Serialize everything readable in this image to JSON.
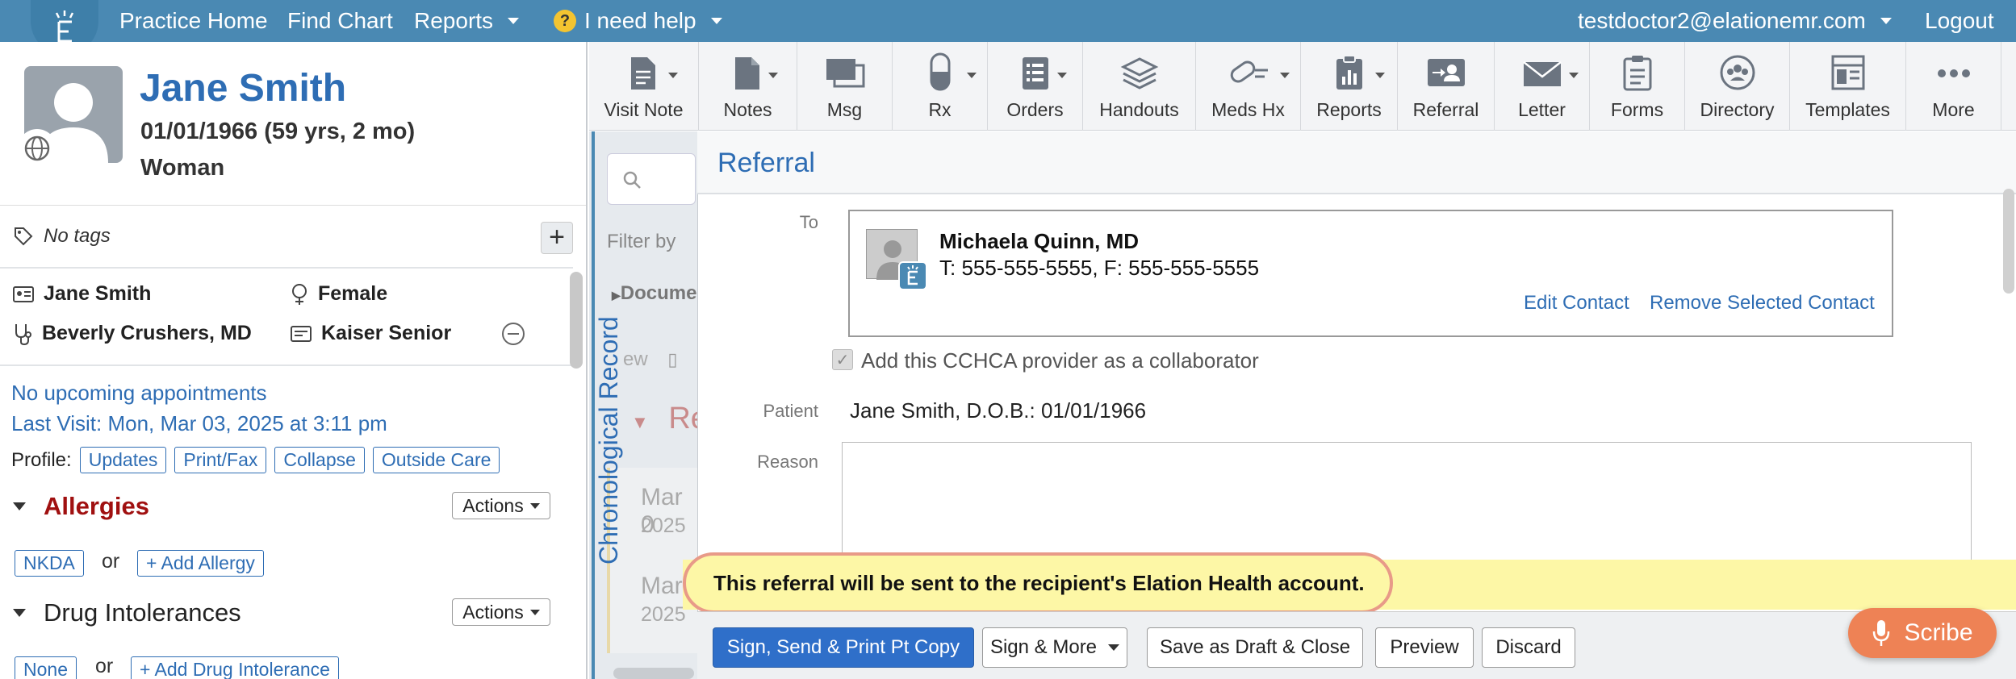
{
  "topnav": {
    "practice_home": "Practice Home",
    "find_chart": "Find Chart",
    "reports": "Reports",
    "help": "I need help",
    "user": "testdoctor2@elationemr.com",
    "logout": "Logout"
  },
  "patient": {
    "name": "Jane Smith",
    "dob": "01/01/1966 (59 yrs, 2 mo)",
    "sex": "Woman",
    "tags": "No tags",
    "legal_name": "Jane Smith",
    "gender": "Female",
    "provider": "Beverly Crushers, MD",
    "insurance": "Kaiser Senior",
    "upcoming": "No upcoming appointments",
    "last_visit": "Last Visit: Mon, Mar 03, 2025 at 3:11 pm"
  },
  "profile": {
    "label": "Profile:",
    "buttons": [
      "Updates",
      "Print/Fax",
      "Collapse",
      "Outside Care"
    ]
  },
  "allergies": {
    "title": "Allergies",
    "actions": "Actions",
    "nkda": "NKDA",
    "or": "or",
    "add": "+ Add Allergy"
  },
  "intolerances": {
    "title": "Drug Intolerances",
    "actions": "Actions",
    "none": "None",
    "or": "or",
    "add": "+ Add Drug Intolerance"
  },
  "toolbar": {
    "items": [
      "Visit Note",
      "Notes",
      "Msg",
      "Rx",
      "Orders",
      "Handouts",
      "Meds Hx",
      "Reports",
      "Referral",
      "Letter",
      "Forms",
      "Directory",
      "Templates",
      "More"
    ]
  },
  "middle": {
    "filter_by": "Filter by",
    "documents": "Docume",
    "view": "ew",
    "re": "Re",
    "chrono": "Chronological Record",
    "card1_month": "Mar 0",
    "card1_year": "2025",
    "card2_month": "Mar",
    "card2_year": "2025"
  },
  "referral": {
    "title": "Referral",
    "to_label": "To",
    "contact_name": "Michaela Quinn, MD",
    "contact_phone": "T: 555-555-5555, F: 555-555-5555",
    "edit_contact": "Edit Contact",
    "remove_contact": "Remove Selected Contact",
    "collaborator": "Add this CCHCA provider as a collaborator",
    "patient_label": "Patient",
    "patient_value": "Jane Smith, D.O.B.: 01/01/1966",
    "reason_label": "Reason",
    "notice": "This referral will be sent to the recipient's Elation Health account."
  },
  "footer": {
    "sign_send": "Sign, Send & Print Pt Copy",
    "sign_more": "Sign & More",
    "save_draft": "Save as Draft & Close",
    "preview": "Preview",
    "discard": "Discard"
  },
  "scribe": {
    "label": "Scribe"
  },
  "colors": {
    "topbar": "#4a89b3",
    "link": "#2e6db4",
    "primary_button": "#2f6fc9",
    "notice_bg": "#fdf7a6",
    "scribe": "#ee8255",
    "allergy_title": "#a01010"
  }
}
